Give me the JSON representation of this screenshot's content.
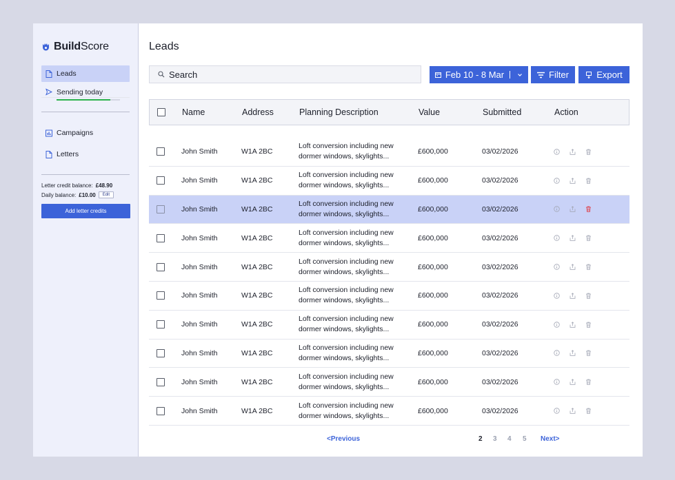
{
  "brand": {
    "bold": "Build",
    "regular": "Score"
  },
  "sidebar": {
    "leads": "Leads",
    "sending_today": "Sending today",
    "sending_progress": 0.85,
    "campaigns": "Campaigns",
    "letters": "Letters",
    "credit_label": "Letter credit balance:",
    "credit_value": "£48.90",
    "daily_label": "Daily balance:",
    "daily_value": "£10.00",
    "edit": "Edit",
    "add_credits": "Add letter credits"
  },
  "main": {
    "title": "Leads",
    "search_placeholder": "Search",
    "date_range": "Feb 10 - 8 Mar",
    "filter": "Filter",
    "export": "Export"
  },
  "table": {
    "headers": [
      "Name",
      "Address",
      "Planning Description",
      "Value",
      "Submitted",
      "Action"
    ],
    "rows": [
      {
        "name": "John Smith",
        "address": "W1A 2BC",
        "desc1": "Loft conversion including new",
        "desc2": "dormer windows, skylights...",
        "value": "£600,000",
        "submitted": "03/02/2026"
      },
      {
        "name": "John Smith",
        "address": "W1A 2BC",
        "desc1": "Loft conversion including new",
        "desc2": "dormer windows, skylights...",
        "value": "£600,000",
        "submitted": "03/02/2026"
      },
      {
        "name": "John Smith",
        "address": "W1A 2BC",
        "desc1": "Loft conversion including new",
        "desc2": "dormer windows, skylights...",
        "value": "£600,000",
        "submitted": "03/02/2026"
      },
      {
        "name": "John Smith",
        "address": "W1A 2BC",
        "desc1": "Loft conversion including new",
        "desc2": "dormer windows, skylights...",
        "value": "£600,000",
        "submitted": "03/02/2026"
      },
      {
        "name": "John Smith",
        "address": "W1A 2BC",
        "desc1": "Loft conversion including new",
        "desc2": "dormer windows, skylights...",
        "value": "£600,000",
        "submitted": "03/02/2026"
      },
      {
        "name": "John Smith",
        "address": "W1A 2BC",
        "desc1": "Loft conversion including new",
        "desc2": "dormer windows, skylights...",
        "value": "£600,000",
        "submitted": "03/02/2026"
      },
      {
        "name": "John Smith",
        "address": "W1A 2BC",
        "desc1": "Loft conversion including new",
        "desc2": "dormer windows, skylights...",
        "value": "£600,000",
        "submitted": "03/02/2026"
      },
      {
        "name": "John Smith",
        "address": "W1A 2BC",
        "desc1": "Loft conversion including new",
        "desc2": "dormer windows, skylights...",
        "value": "£600,000",
        "submitted": "03/02/2026"
      },
      {
        "name": "John Smith",
        "address": "W1A 2BC",
        "desc1": "Loft conversion including new",
        "desc2": "dormer windows, skylights...",
        "value": "£600,000",
        "submitted": "03/02/2026"
      },
      {
        "name": "John Smith",
        "address": "W1A 2BC",
        "desc1": "Loft conversion including new",
        "desc2": "dormer windows, skylights...",
        "value": "£600,000",
        "submitted": "03/02/2026"
      }
    ],
    "selected_row": 2,
    "action_icons": [
      "info-icon",
      "share-icon",
      "trash-icon"
    ]
  },
  "pager": {
    "prev": "<Previous",
    "pages": [
      "2",
      "3",
      "4",
      "5"
    ],
    "current": "2",
    "next": "Next>"
  },
  "colors": {
    "accent": "#3c63d9",
    "selected": "#c9d2f7",
    "danger": "#e0353b",
    "progress": "#2bb24c"
  }
}
